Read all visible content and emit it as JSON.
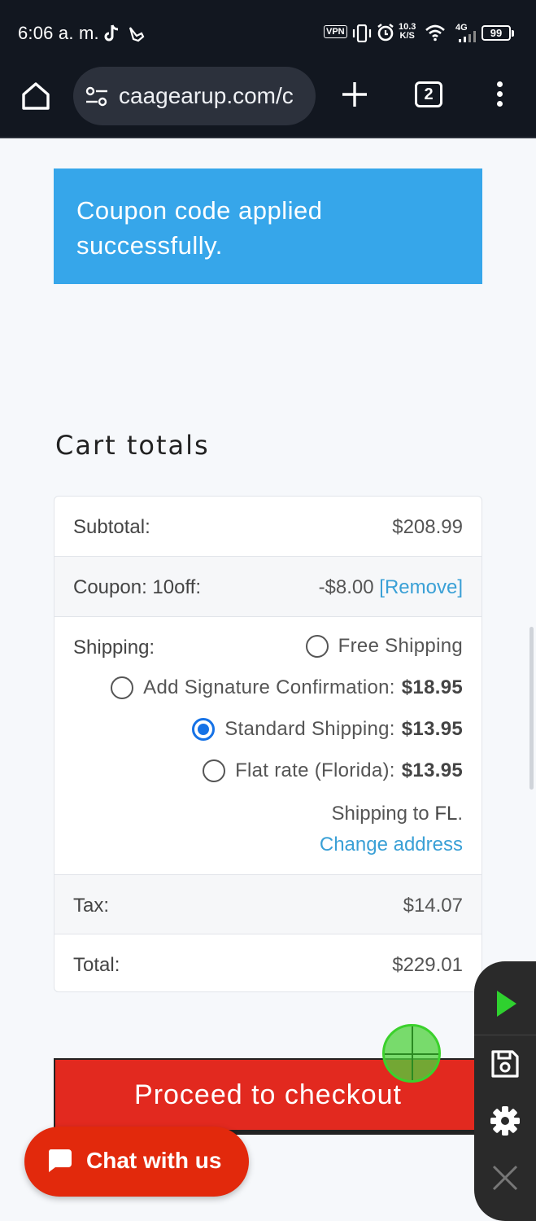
{
  "status_bar": {
    "time": "6:06 a. m.",
    "vpn": "VPN",
    "speed_value": "10.3",
    "speed_unit": "K/S",
    "network": "4G",
    "battery": "99",
    "icons": [
      "tiktok-icon",
      "gesture-icon",
      "vibrate-icon",
      "alarm-icon",
      "wifi-icon",
      "signal-icon"
    ]
  },
  "browser": {
    "url": "caagearup.com/c",
    "tab_count": "2",
    "icons": [
      "home-icon",
      "site-settings-icon",
      "new-tab-icon",
      "tab-switcher-icon",
      "more-menu-icon"
    ]
  },
  "notice": {
    "text": "Coupon code applied successfully.",
    "color": "#36a6ea"
  },
  "cart": {
    "heading": "Cart totals",
    "subtotal_label": "Subtotal:",
    "subtotal_value": "$208.99",
    "coupon_label": "Coupon: 10off:",
    "coupon_value": "-$8.00",
    "coupon_remove": "[Remove]",
    "shipping_label": "Shipping:",
    "shipping_options": [
      {
        "label": "Free Shipping",
        "price": "",
        "selected": false
      },
      {
        "label": "Add Signature Confirmation:",
        "price": "$18.95",
        "selected": false
      },
      {
        "label": "Standard Shipping:",
        "price": "$13.95",
        "selected": true
      },
      {
        "label": "Flat rate (Florida):",
        "price": "$13.95",
        "selected": false
      }
    ],
    "shipping_to_prefix": "Shipping to",
    "shipping_to_state": "FL",
    "shipping_to_suffix": ".",
    "change_address": "Change address",
    "tax_label": "Tax:",
    "tax_value": "$14.07",
    "total_label": "Total:",
    "total_value": "$229.01"
  },
  "checkout": {
    "label": "Proceed to checkout",
    "color": "#e2291f"
  },
  "chat": {
    "label": "Chat with us",
    "color": "#e2290c"
  },
  "recorder_panel": {
    "icons": [
      "play-icon",
      "save-icon",
      "settings-icon",
      "close-icon"
    ],
    "accent": "#2fd12f"
  }
}
